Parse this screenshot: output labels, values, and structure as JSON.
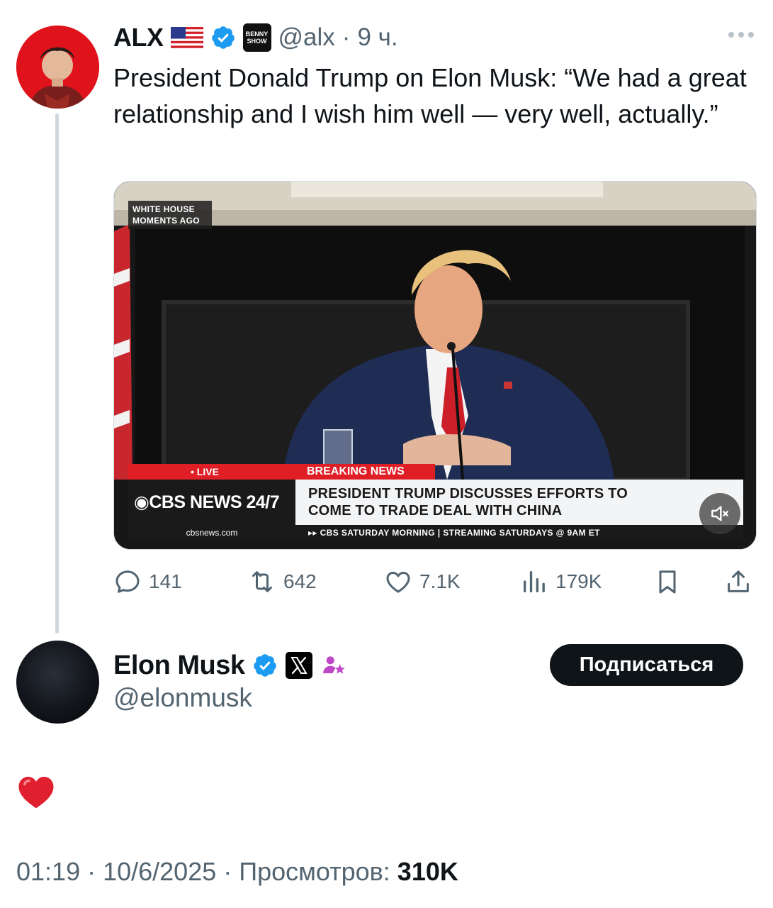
{
  "tweet": {
    "author_name": "ALX",
    "handle": "@alx",
    "separator": "·",
    "time": "9 ч.",
    "badge_label": "BENNY SHOW",
    "text": "President Donald Trump on Elon Musk: “We had a great relationship and I wish him well — very well, actually.”",
    "media": {
      "corner_line1": "WHITE HOUSE",
      "corner_line2": "MOMENTS AGO",
      "live_label": "• LIVE",
      "breaking_label": "BREAKING NEWS",
      "network_logo": "◉CBS NEWS 24/7",
      "url": "cbsnews.com",
      "headline_line1": "PRESIDENT TRUMP DISCUSSES EFFORTS TO",
      "headline_line2": "COME TO TRADE DEAL WITH CHINA",
      "ticker": "▸▸ CBS SATURDAY MORNING | STREAMING SATURDAYS @ 9AM ET"
    },
    "actions": {
      "replies": "141",
      "reposts": "642",
      "likes": "7.1K",
      "views": "179K"
    },
    "colors": {
      "verified": "#1d9bf0",
      "text_secondary": "#536471",
      "thread_line": "#cfd9de",
      "avatar_bg": "#e0121b"
    }
  },
  "reply": {
    "author_name": "Elon Musk",
    "handle": "@elonmusk",
    "follow_label": "Подписаться",
    "content_emoji": "heart",
    "timestamp": "01:19 · 10/6/2025 · ",
    "views_label": "Просмотров: ",
    "views_count": "310K"
  }
}
